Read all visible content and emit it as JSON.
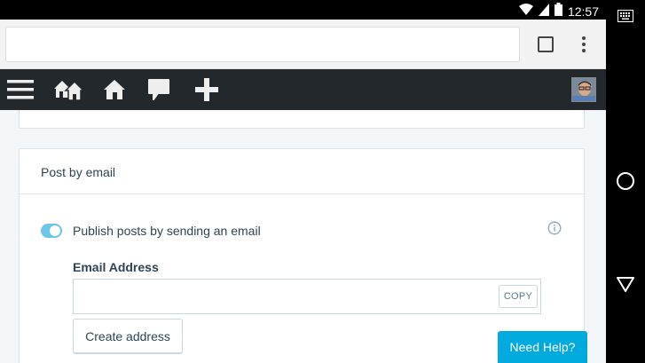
{
  "status_bar": {
    "time": "12:57",
    "icons": [
      "wifi-icon",
      "cell-signal-icon",
      "battery-icon"
    ]
  },
  "nav_bar": {
    "icons": [
      "keyboard-icon",
      "home-circle-icon",
      "back-triangle-icon"
    ]
  },
  "browser": {
    "url_value": "",
    "icons": [
      "tabs-square-icon",
      "overflow-menu-icon"
    ]
  },
  "admin_bar": {
    "icons": [
      "menu-hamburger-icon",
      "my-sites-icon",
      "home-icon",
      "notifications-bubble-icon",
      "add-plus-icon",
      "avatar"
    ]
  },
  "post_by_email": {
    "title": "Post by email",
    "toggle_label": "Publish posts by sending an email",
    "toggle_on": true,
    "email_label": "Email Address",
    "email_value": "",
    "copy_label": "COPY",
    "create_label": "Create address"
  },
  "help": {
    "label": "Need Help?"
  },
  "colors": {
    "admin_bar": "#23282d",
    "toggle": "#6bc6e8",
    "help_button": "#00aadc",
    "text": "#2e4453"
  }
}
